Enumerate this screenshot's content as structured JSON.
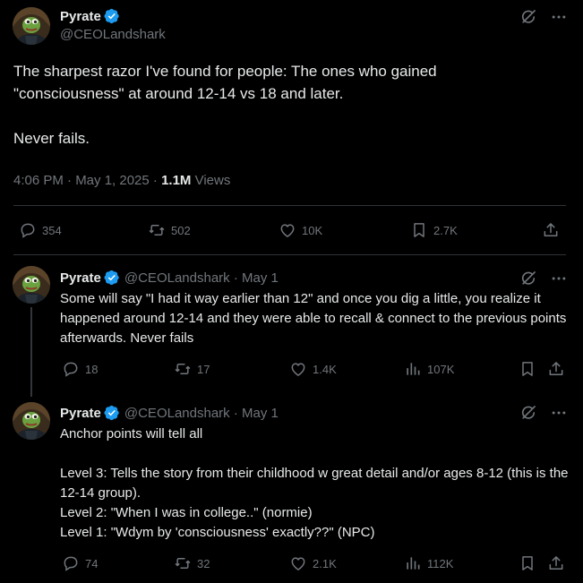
{
  "main": {
    "author": "Pyrate",
    "handle": "@CEOLandshark",
    "text": "The sharpest razor I've found for people: The ones who gained \"consciousness\" at around 12-14 vs 18 and later.\n\nNever fails.",
    "time": "4:06 PM · May 1, 2025 · ",
    "views_count": "1.1M",
    "views_label": " Views",
    "actions": {
      "replies": "354",
      "reposts": "502",
      "likes": "10K",
      "bookmarks": "2.7K"
    }
  },
  "replies": [
    {
      "author": "Pyrate",
      "handle_date": "@CEOLandshark · May 1",
      "text": "Some will say \"I had it way earlier than 12\" and once you dig a little, you realize it happened around 12-14 and they were able to recall & connect to the previous points afterwards. Never fails",
      "actions": {
        "replies": "18",
        "reposts": "17",
        "likes": "1.4K",
        "views": "107K"
      }
    },
    {
      "author": "Pyrate",
      "handle_date": "@CEOLandshark · May 1",
      "text": "Anchor points will tell all\n\nLevel 3: Tells the story from their childhood w great detail and/or ages 8-12 (this is the 12-14 group).\nLevel 2: \"When I was in college..\" (normie)\nLevel 1: \"Wdym by 'consciousness' exactly??\" (NPC)",
      "actions": {
        "replies": "74",
        "reposts": "32",
        "likes": "2.1K",
        "views": "112K"
      }
    }
  ],
  "colors": {
    "background": "#000000",
    "text": "#e7e9ea",
    "muted": "#71767b",
    "verified": "#1d9bf0",
    "divider": "#2f3336"
  }
}
